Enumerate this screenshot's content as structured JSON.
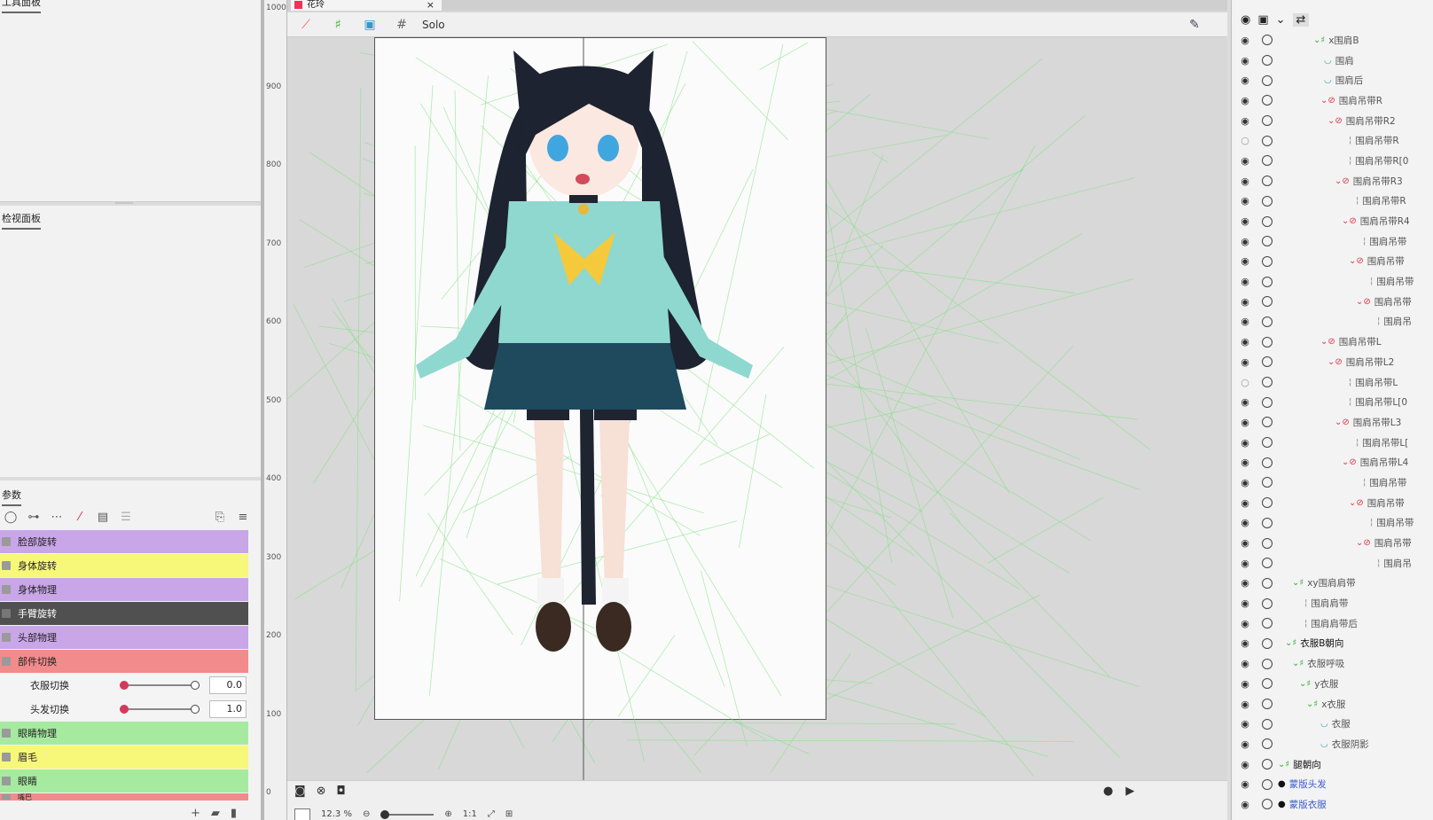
{
  "left_top": {
    "title": "工具面板"
  },
  "inspector": {
    "title": "检视面板"
  },
  "params": {
    "title": "参数",
    "groups": [
      {
        "label": "脸部旋转",
        "color": "#c9a6e8"
      },
      {
        "label": "身体旋转",
        "color": "#f7f77a"
      },
      {
        "label": "身体物理",
        "color": "#c9a6e8"
      },
      {
        "label": "手臂旋转",
        "color": "#505050"
      },
      {
        "label": "头部物理",
        "color": "#c9a6e8"
      },
      {
        "label": "部件切换",
        "color": "#f28b8b"
      }
    ],
    "sliders": [
      {
        "label": "衣服切换",
        "value": "0.0",
        "fraction": 0.0
      },
      {
        "label": "头发切换",
        "value": "1.0",
        "fraction": 1.0
      }
    ],
    "groups2": [
      {
        "label": "眼睛物理",
        "color": "#a6eaa0"
      },
      {
        "label": "眉毛",
        "color": "#f7f77a"
      },
      {
        "label": "眼睛",
        "color": "#a6eaa0"
      },
      {
        "label": "嘴巴",
        "color": "#f28b8b"
      }
    ]
  },
  "ruler": {
    "ticks": [
      "1000",
      "900",
      "800",
      "700",
      "600",
      "500",
      "400",
      "300",
      "200",
      "100",
      "0"
    ]
  },
  "document": {
    "tab_label": "花玲",
    "close": "×"
  },
  "canvas_toolbar": {
    "solo": "Solo"
  },
  "canvas_bottom": {
    "zoom": "12.3 %",
    "ratio": "1:1"
  },
  "layers": [
    {
      "indent": 110,
      "name": "x围肩B",
      "eye": true,
      "icon": "deformer"
    },
    {
      "indent": 122,
      "name": "围肩",
      "eye": true,
      "icon": "art"
    },
    {
      "indent": 122,
      "name": "围肩后",
      "eye": true,
      "icon": "art"
    },
    {
      "indent": 118,
      "name": "围肩吊带R",
      "eye": true,
      "icon": "rot"
    },
    {
      "indent": 126,
      "name": "围肩吊带R2",
      "eye": true,
      "icon": "rot"
    },
    {
      "indent": 150,
      "name": "围肩吊带R",
      "eye": false,
      "icon": "line"
    },
    {
      "indent": 150,
      "name": "围肩吊带R[0",
      "eye": true,
      "icon": "line"
    },
    {
      "indent": 134,
      "name": "围肩吊带R3",
      "eye": true,
      "icon": "rot"
    },
    {
      "indent": 158,
      "name": "围肩吊带R",
      "eye": true,
      "icon": "line"
    },
    {
      "indent": 142,
      "name": "围肩吊带R4",
      "eye": true,
      "icon": "rot"
    },
    {
      "indent": 166,
      "name": "围肩吊带",
      "eye": true,
      "icon": "line"
    },
    {
      "indent": 150,
      "name": "围肩吊带",
      "eye": true,
      "icon": "rot"
    },
    {
      "indent": 174,
      "name": "围肩吊带",
      "eye": true,
      "icon": "line"
    },
    {
      "indent": 158,
      "name": "围肩吊带",
      "eye": true,
      "icon": "rot"
    },
    {
      "indent": 182,
      "name": "围肩吊",
      "eye": true,
      "icon": "line"
    },
    {
      "indent": 118,
      "name": "围肩吊带L",
      "eye": true,
      "icon": "rot"
    },
    {
      "indent": 126,
      "name": "围肩吊带L2",
      "eye": true,
      "icon": "rot"
    },
    {
      "indent": 150,
      "name": "围肩吊带L",
      "eye": false,
      "icon": "line"
    },
    {
      "indent": 150,
      "name": "围肩吊带L[0",
      "eye": true,
      "icon": "line"
    },
    {
      "indent": 134,
      "name": "围肩吊带L3",
      "eye": true,
      "icon": "rot"
    },
    {
      "indent": 158,
      "name": "围肩吊带L[",
      "eye": true,
      "icon": "line"
    },
    {
      "indent": 142,
      "name": "围肩吊带L4",
      "eye": true,
      "icon": "rot"
    },
    {
      "indent": 166,
      "name": "围肩吊带",
      "eye": true,
      "icon": "line"
    },
    {
      "indent": 150,
      "name": "围肩吊带",
      "eye": true,
      "icon": "rot"
    },
    {
      "indent": 174,
      "name": "围肩吊带",
      "eye": true,
      "icon": "line"
    },
    {
      "indent": 158,
      "name": "围肩吊带",
      "eye": true,
      "icon": "rot"
    },
    {
      "indent": 182,
      "name": "围肩吊",
      "eye": true,
      "icon": "line"
    },
    {
      "indent": 86,
      "name": "xy围肩肩带",
      "eye": true,
      "icon": "deformer"
    },
    {
      "indent": 100,
      "name": "围肩肩带",
      "eye": true,
      "icon": "line"
    },
    {
      "indent": 100,
      "name": "围肩肩带后",
      "eye": true,
      "icon": "line"
    },
    {
      "indent": 78,
      "name": "衣服B朝向",
      "eye": true,
      "icon": "deformer",
      "bold": true
    },
    {
      "indent": 86,
      "name": "衣服呼吸",
      "eye": true,
      "icon": "deformer"
    },
    {
      "indent": 94,
      "name": "y衣服",
      "eye": true,
      "icon": "deformer"
    },
    {
      "indent": 102,
      "name": "x衣服",
      "eye": true,
      "icon": "deformer"
    },
    {
      "indent": 118,
      "name": "衣服",
      "eye": true,
      "icon": "art"
    },
    {
      "indent": 118,
      "name": "衣服阴影",
      "eye": true,
      "icon": "art"
    },
    {
      "indent": 70,
      "name": "腿朝向",
      "eye": true,
      "icon": "deformer",
      "bold": true
    },
    {
      "indent": 70,
      "name": "蒙版头发",
      "eye": true,
      "icon": "mask",
      "blue": true
    },
    {
      "indent": 70,
      "name": "蒙版衣服",
      "eye": true,
      "icon": "mask",
      "blue": true
    }
  ]
}
